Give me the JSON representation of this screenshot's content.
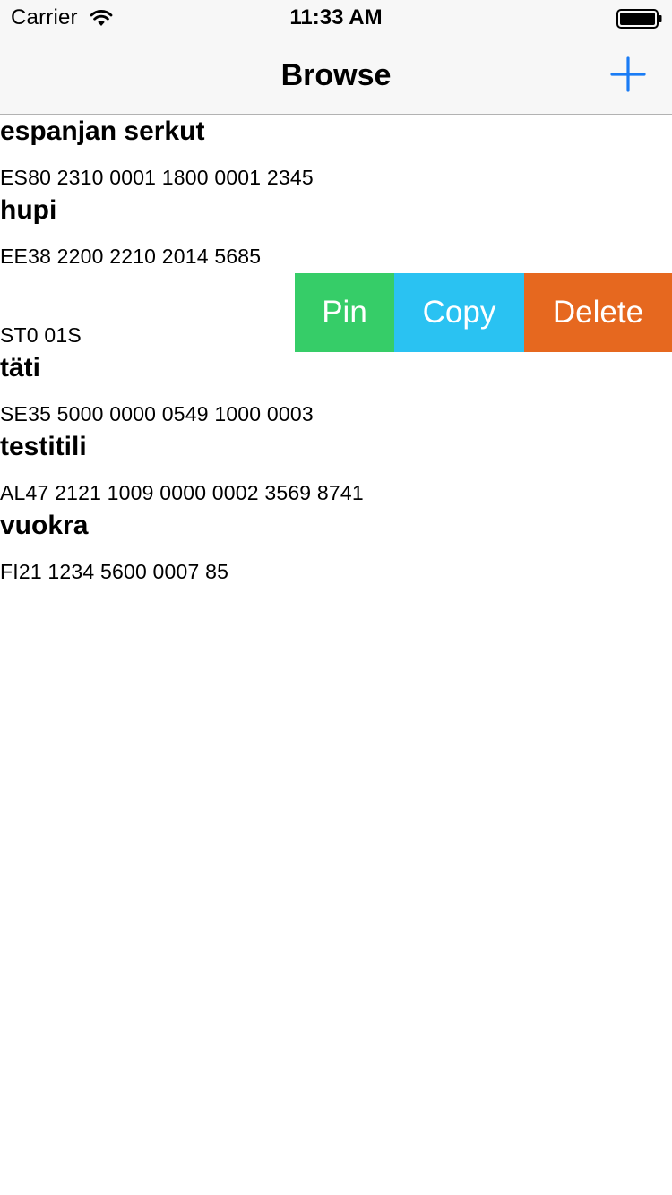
{
  "status_bar": {
    "carrier": "Carrier",
    "time": "11:33 AM",
    "wifi_icon": "wifi-icon",
    "battery_icon": "battery-icon"
  },
  "nav": {
    "title": "Browse",
    "add_icon": "plus-icon",
    "accent_color": "#1a7cf5"
  },
  "accounts": [
    {
      "name": "espanjan serkut",
      "iban": "ES80 2310 0001 1800 0001 2345"
    },
    {
      "name": "hupi",
      "iban": "EE38 2200 2210 2014 5685"
    },
    {
      "name": "",
      "iban": "ST0 01S"
    },
    {
      "name": "täti",
      "iban": "SE35 5000 0000 0549 1000 0003"
    },
    {
      "name": "testitili",
      "iban": "AL47 2121 1009 0000 0002 3569 8741"
    },
    {
      "name": "vuokra",
      "iban": "FI21 1234 5600 0007 85"
    }
  ],
  "swipe_actions": {
    "pin": "Pin",
    "copy": "Copy",
    "delete": "Delete",
    "colors": {
      "pin": "#36cd68",
      "copy": "#2ac2f2",
      "delete": "#e6681f"
    }
  }
}
